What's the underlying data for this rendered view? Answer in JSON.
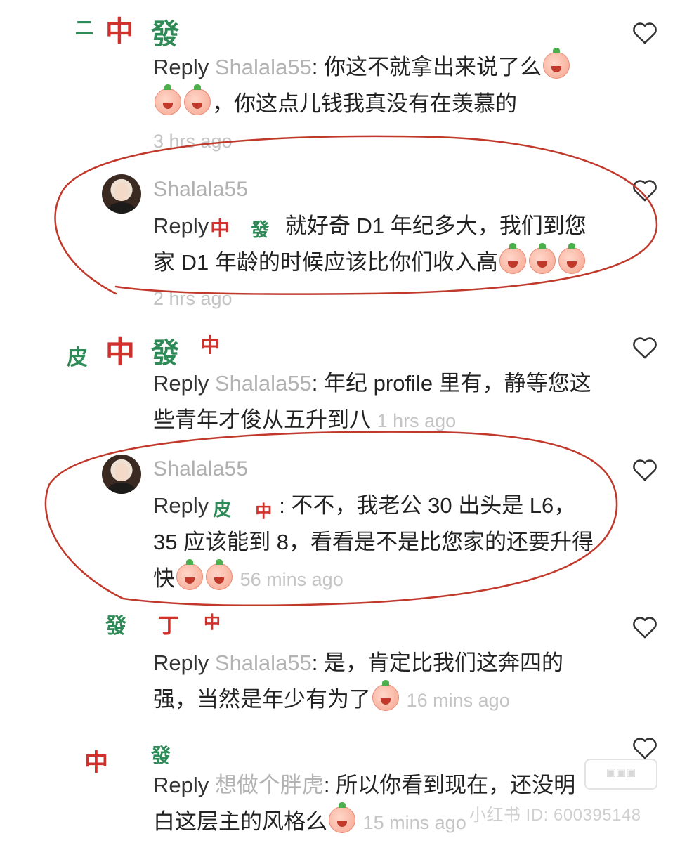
{
  "comments": [
    {
      "reply_word": "Reply",
      "reply_to": "Shalala55",
      "text_a": ": 你这不就拿出来说了么",
      "text_b": "，你这点儿钱我真没有在羡慕的",
      "time": "3 hrs ago"
    },
    {
      "username": "Shalala55",
      "reply_word": "Reply",
      "text_a": " 就好奇 D1 年纪多大，我们到您家 D1 年龄的时候应该比你们收入高",
      "time": "2 hrs ago"
    },
    {
      "reply_word": "Reply",
      "reply_to": "Shalala55",
      "text_a": ": 年纪 profile 里有，静等您这些青年才俊从五升到八",
      "time": "1 hrs ago"
    },
    {
      "username": "Shalala55",
      "reply_word": "Reply",
      "text_a": ": 不不，我老公 30 出头是 L6，35 应该能到 8，看看是不是比您家的还要升得快",
      "time": "56 mins ago"
    },
    {
      "reply_word": "Reply",
      "reply_to": "Shalala55",
      "text_a": ": 是，肯定比我们这奔四的强，当然是年少有为了",
      "time": "16 mins ago"
    },
    {
      "reply_word": "Reply",
      "reply_to": "想做个胖虎",
      "text_a": ": 所以你看到现在，还没明白这层主的风格么",
      "time": "15 mins ago"
    }
  ],
  "icons": {
    "like": "heart-outline-icon",
    "emoji": "crying-peach-emoji"
  },
  "watermark": "小红书 ID: 600395148",
  "colors": {
    "annotation_circle": "#c0392b",
    "username": "#b0b0b0",
    "timestamp": "#c4c4c4",
    "text": "#222222"
  }
}
